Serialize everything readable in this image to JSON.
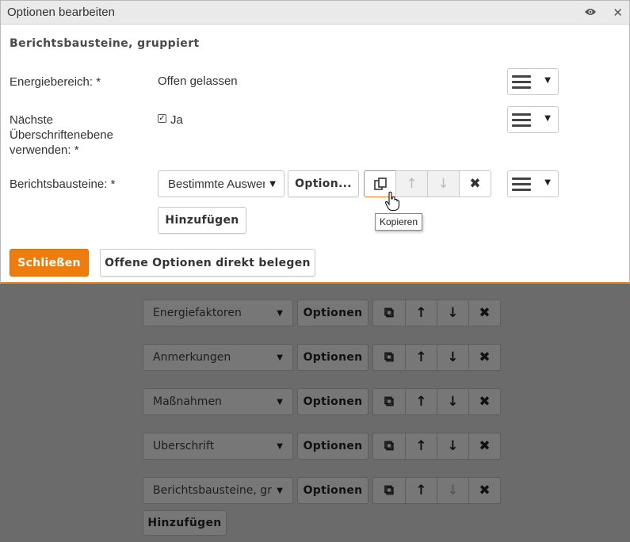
{
  "window": {
    "title": "Optionen bearbeiten",
    "view_icon": "eye-icon",
    "close_icon": "close-icon"
  },
  "dialog": {
    "section_title": "Berichtsbausteine, gruppiert",
    "energy_label": "Energiebereich: *",
    "energy_value": "Offen gelassen",
    "heading_label_1": "Nächste",
    "heading_label_2": "Überschriftenebene",
    "heading_label_3": "verwenden: *",
    "heading_checkbox_checked": true,
    "heading_checkbox_label": "Ja",
    "modules_label": "Berichtsbausteine: *",
    "modules_select_value": "Bestimmte Auswertung",
    "options_button": "Option...",
    "copy_tooltip": "Kopieren",
    "add_button": "Hinzufügen",
    "close_button": "Schließen",
    "assign_button": "Offene Optionen direkt belegen"
  },
  "background_form": {
    "rows": [
      {
        "select": "Energiefaktoren",
        "options": "Optionen"
      },
      {
        "select": "Anmerkungen",
        "options": "Optionen"
      },
      {
        "select": "Maßnahmen",
        "options": "Optionen"
      },
      {
        "select": "Überschrift",
        "options": "Optionen"
      },
      {
        "select": "Berichtsbausteine, gruppiert",
        "options": "Optionen"
      }
    ],
    "add_button": "Hinzufügen"
  },
  "colors": {
    "accent": "#ee7d0e",
    "overlay": "#6b6b6b"
  }
}
